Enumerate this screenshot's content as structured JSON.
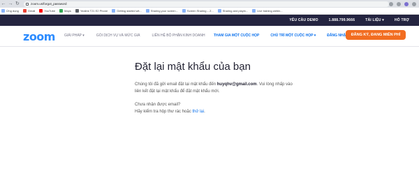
{
  "browser": {
    "url": "zoom.us/forgot_password"
  },
  "bookmarks": [
    {
      "label": "Ứng dụng"
    },
    {
      "label": "Gmail"
    },
    {
      "label": "YouTube"
    },
    {
      "label": "Maps"
    },
    {
      "label": "Yealink T21 E2 Phone"
    },
    {
      "label": "Getting started wit..."
    },
    {
      "label": "Sharing your screen..."
    },
    {
      "label": "Screen Sharing – Z..."
    },
    {
      "label": "Sharing and playin..."
    },
    {
      "label": "Live training webin..."
    }
  ],
  "top_bar": {
    "request_demo": "YÊU CẦU DEMO",
    "phone": "1.888.799.9666",
    "resources": "TÀI LIỆU ▾",
    "support": "HỖ TRỢ"
  },
  "nav": {
    "logo": "zoom",
    "solutions": "GIẢI PHÁP ▾",
    "plans": "GÓI DỊCH VỤ VÀ MỨC GIÁ",
    "contact_sales": "LIÊN HỆ BỘ PHẬN KINH DOANH",
    "join_meeting": "THAM GIA MỘT CUỘC HỌP",
    "host_meeting": "CHỦ TRÌ MỘT CUỘC HỌP ▾",
    "sign_in": "ĐĂNG NHẬP",
    "sign_up": "ĐĂNG KÝ, ĐANG MIỄN PHÍ"
  },
  "main": {
    "title": "Đặt lại mật khẩu của bạn",
    "sent_prefix": "Chúng tôi đã gửi email đặt lại mật khẩu đến ",
    "email": "huyqhv@gmail.com",
    "sent_suffix": ". Vui lòng nhấp vào liên kết đặt lại mật khẩu để đặt mật khẩu mới.",
    "not_received": "Chưa nhận được email?",
    "check_prefix": "Hãy kiểm tra hộp thư rác hoặc ",
    "retry_link": "thử lại",
    "check_suffix": "."
  }
}
